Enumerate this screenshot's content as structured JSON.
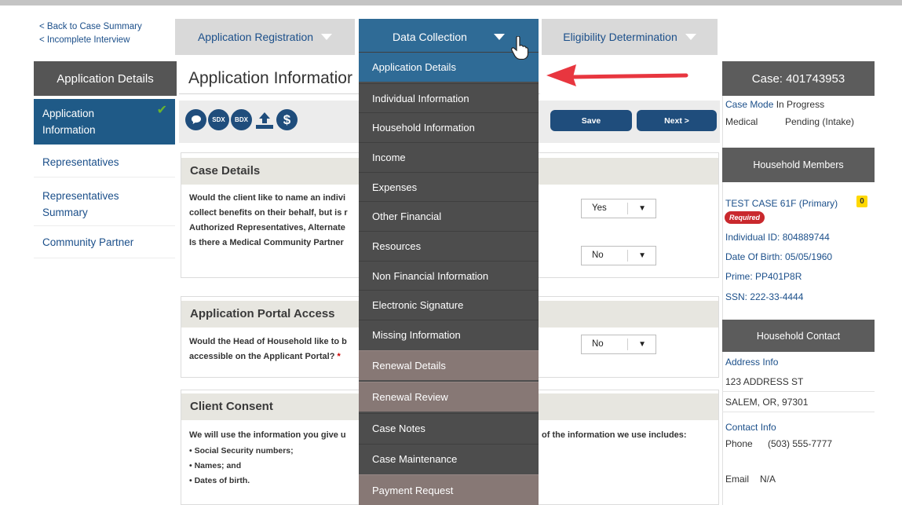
{
  "back_links": [
    "< Back to Case Summary",
    "< Incomplete Interview"
  ],
  "nav": {
    "registration": "Application Registration",
    "data_collection": "Data Collection",
    "eligibility": "Eligibility Determination"
  },
  "sidebar": {
    "header": "Application Details",
    "items": [
      {
        "label": "Application Information"
      },
      {
        "label": "Representatives"
      },
      {
        "label": "Representatives Summary"
      },
      {
        "label": "Community Partner"
      }
    ]
  },
  "main": {
    "title": "Application Informatior",
    "toolbar": {
      "icons": [
        "chat-icon",
        "sdx-icon",
        "bdx-icon",
        "upload-icon",
        "dollar-icon"
      ],
      "sdx_label": "SDX",
      "bdx_label": "BDX",
      "save_label": "Save",
      "next_label": "Next >"
    },
    "case_details": {
      "heading": "Case Details",
      "q1_line1": "Would the client like to name an indivi",
      "q1_line2": "collect benefits on their behalf, but is r",
      "q1_line3": "Authorized Representatives, Alternate",
      "q1_value": "Yes",
      "q2": "Is there a Medical Community Partner",
      "q2_value": "No"
    },
    "portal_access": {
      "heading": "Application Portal Access",
      "q_line1": "Would the Head of Household like to b",
      "q_line2": "accessible on the Applicant Portal?",
      "required_mark": "*",
      "value": "No"
    },
    "client_consent": {
      "heading": "Client Consent",
      "text_left": "We will use the information you give u",
      "text_right": "of the information we use includes:",
      "bullets": [
        "• Social Security numbers;",
        "• Names; and",
        "• Dates of birth."
      ]
    }
  },
  "dropdown": {
    "items": [
      "Application Details",
      "Individual Information",
      "Household Information",
      "Income",
      "Expenses",
      "Other Financial",
      "Resources",
      "Non Financial Information",
      "Electronic Signature",
      "Missing Information",
      "Renewal Details",
      "Renewal Review",
      "Case Notes",
      "Case Maintenance",
      "Payment Request"
    ]
  },
  "right": {
    "case_title": "Case: 401743953",
    "case_mode_label": "Case Mode",
    "case_mode_value": "In Progress",
    "medical_label": "Medical",
    "medical_value": "Pending (Intake)",
    "household_members_heading": "Household Members",
    "member_name": "TEST CASE 61F (Primary)",
    "member_count": "0",
    "required_badge": "Required",
    "individual_id": "Individual ID: 804889744",
    "dob": "Date Of Birth: 05/05/1960",
    "prime": "Prime: PP401P8R",
    "ssn": "SSN: 222-33-4444",
    "household_contact_heading": "Household Contact",
    "address_info_label": "Address Info",
    "address_line1": "123 ADDRESS ST",
    "address_line2": "SALEM, OR, 97301",
    "contact_info_label": "Contact Info",
    "phone_label": "Phone",
    "phone_value": "(503) 555-7777",
    "email_label": "Email",
    "email_value": "N/A"
  },
  "colors": {
    "primary_blue": "#2f6b96",
    "dark_blue": "#1f4d7c",
    "link_blue": "#1b4f8a",
    "menu_bg": "#4d4d4d",
    "success_green": "#6ab42d",
    "required_red": "#c9282d",
    "annotation_arrow": "#e8363f"
  }
}
